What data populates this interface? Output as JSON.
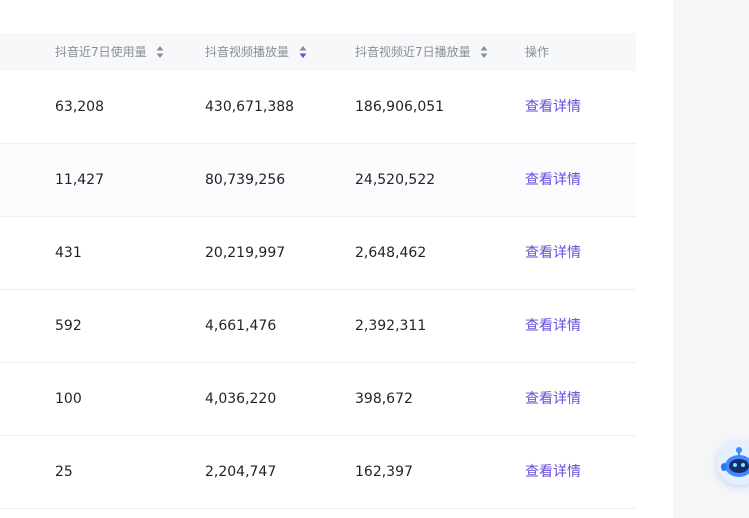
{
  "table": {
    "headers": [
      "抖音近7日使用量",
      "抖音视频播放量",
      "抖音视频近7日播放量",
      "操作"
    ],
    "rows": [
      {
        "usage_7d": "63,208",
        "plays": "430,671,388",
        "plays_7d": "186,906,051",
        "action": "查看详情"
      },
      {
        "usage_7d": "11,427",
        "plays": "80,739,256",
        "plays_7d": "24,520,522",
        "action": "查看详情"
      },
      {
        "usage_7d": "431",
        "plays": "20,219,997",
        "plays_7d": "2,648,462",
        "action": "查看详情"
      },
      {
        "usage_7d": "592",
        "plays": "4,661,476",
        "plays_7d": "2,392,311",
        "action": "查看详情"
      },
      {
        "usage_7d": "100",
        "plays": "4,036,220",
        "plays_7d": "398,672",
        "action": "查看详情"
      },
      {
        "usage_7d": "25",
        "plays": "2,204,747",
        "plays_7d": "162,397",
        "action": "查看详情"
      }
    ]
  },
  "colors": {
    "accent": "#6a4cd8",
    "sort_active": "#6a4cd8",
    "sort_inactive": "#8a8e99"
  },
  "icons": {
    "sort": "sort-icon",
    "assistant": "robot-assistant-icon"
  }
}
